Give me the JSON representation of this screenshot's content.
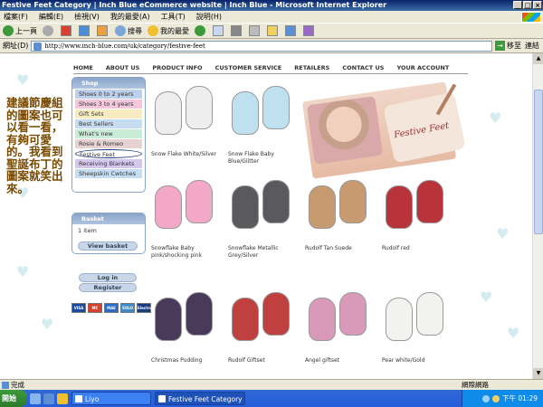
{
  "window": {
    "title": "Festive Feet Category | Inch Blue eCommerce website | Inch Blue - Microsoft Internet Explorer",
    "controls": [
      "_",
      "□",
      "×"
    ]
  },
  "menu": [
    "檔案(F)",
    "編輯(E)",
    "檢視(V)",
    "我的最愛(A)",
    "工具(T)",
    "說明(H)"
  ],
  "toolbar": {
    "back": "上一頁",
    "search": "搜尋",
    "favorites": "我的最愛"
  },
  "address": {
    "label": "網址(D)",
    "url": "http://www.inch-blue.com/uk/category/festive-feet",
    "go": "移至",
    "links": "連結"
  },
  "annotation": "建議節慶組的圖案也可以看一看，有夠可愛的。我看到聖誕布丁的圖案就笑出來。",
  "site": {
    "nav": [
      "HOME",
      "ABOUT US",
      "PRODUCT INFO",
      "CUSTOMER SERVICE",
      "RETAILERS",
      "CONTACT US",
      "YOUR ACCOUNT"
    ],
    "shop": {
      "heading": "Shop",
      "items": [
        {
          "label": "Shoes 0 to 2 years",
          "color": "#bcd0ec"
        },
        {
          "label": "Shoes 3 to 4 years",
          "color": "#f2c6dc"
        },
        {
          "label": "Gift Sets",
          "color": "#f6ecc0"
        },
        {
          "label": "Best Sellers",
          "color": "#c6dcf0"
        },
        {
          "label": "What's new",
          "color": "#c8ecd6"
        },
        {
          "label": "Rosie & Romeo",
          "color": "#e6d2d2"
        },
        {
          "label": "Festive Feet",
          "color": "#ffffff"
        },
        {
          "label": "Receiving Blankets",
          "color": "#d6c8ec"
        },
        {
          "label": "Sheepskin Cwtches",
          "color": "#c6dcf0"
        }
      ]
    },
    "basket": {
      "heading": "Basket",
      "count": "1 item",
      "view": "View basket"
    },
    "login": "Log in",
    "register": "Register",
    "cards": [
      "VISA",
      "MC",
      "MAE",
      "SOLO",
      "Electron"
    ],
    "banner_text": "Festive Feet",
    "products": [
      {
        "name": "Snow Flake White/Silver",
        "color": "#eeeeee"
      },
      {
        "name": "Snow Flake Baby Blue/Glitter",
        "color": "#bfe0ee"
      },
      {
        "name": "Snowflake Baby pink/shocking pink",
        "color": "#f2a8c6"
      },
      {
        "name": "Snowflake Metallic Grey/Silver",
        "color": "#5a5a5e"
      },
      {
        "name": "Rudolf Tan Suede",
        "color": "#c89a70"
      },
      {
        "name": "Rudolf red",
        "color": "#b8333a"
      },
      {
        "name": "Christmas Pudding",
        "color": "#4a3a5a"
      },
      {
        "name": "Rudolf Giftset",
        "color": "#c04040"
      },
      {
        "name": "Angel giftset",
        "color": "#d89ab8"
      },
      {
        "name": "Pear white/Gold",
        "color": "#f2f2ee"
      }
    ]
  },
  "status": {
    "text": "完成",
    "zone": "網際網路"
  },
  "taskbar": {
    "start": "開始",
    "items": [
      "Liyo",
      "Festive Feet Category | Inc..."
    ],
    "clock": "下午 01:29"
  }
}
